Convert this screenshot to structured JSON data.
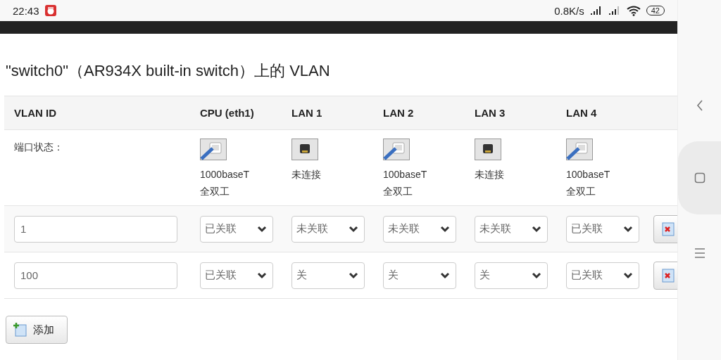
{
  "status_bar": {
    "time": "22:43",
    "net_speed": "0.8K/s",
    "battery": "42"
  },
  "heading": "\"switch0\"（AR934X built-in switch）上的 VLAN",
  "table": {
    "columns": [
      "VLAN ID",
      "CPU (eth1)",
      "LAN 1",
      "LAN 2",
      "LAN 3",
      "LAN 4"
    ],
    "port_status": {
      "label": "端口状态：",
      "ports": [
        {
          "connected": true,
          "status": "1000baseT",
          "duplex": "全双工"
        },
        {
          "connected": false,
          "status": "未连接"
        },
        {
          "connected": true,
          "status": "100baseT",
          "duplex": "全双工"
        },
        {
          "connected": false,
          "status": "未连接"
        },
        {
          "connected": true,
          "status": "100baseT",
          "duplex": "全双工"
        }
      ]
    },
    "rows": [
      {
        "vlan_id": "1",
        "ports": [
          "已关联",
          "未关联",
          "未关联",
          "未关联",
          "已关联"
        ]
      },
      {
        "vlan_id": "100",
        "ports": [
          "已关联",
          "关",
          "关",
          "关",
          "已关联"
        ]
      }
    ]
  },
  "add_button": "添加"
}
